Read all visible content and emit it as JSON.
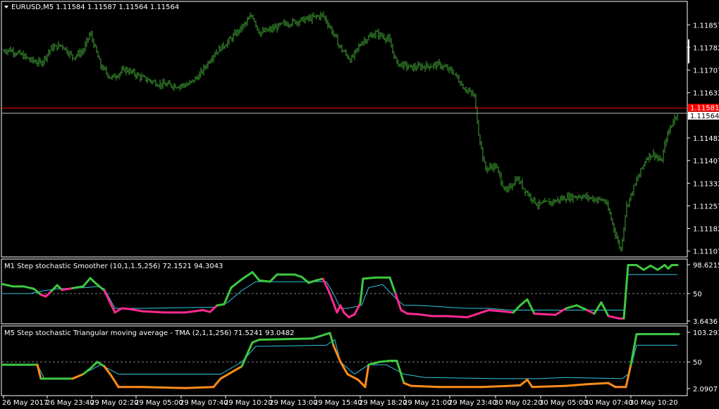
{
  "colors": {
    "background": "#000000",
    "frame": "#ffffff",
    "bar": "#3fa535",
    "bid_line": "#c0c0c0",
    "ask_line": "#ff0000",
    "stoch_up": "#3fc83f",
    "stoch_down": "#ff2a90",
    "tma_down": "#ff8c1a",
    "signal": "#33c7e0",
    "level": "#808080"
  },
  "header": {
    "symbol_menu_icon": "triangle-down-icon",
    "text": "EURUSD,M5  1.11584 1.11587 1.11564 1.11564"
  },
  "price_badges": {
    "ask": "1.11581",
    "bid": "1.11564"
  },
  "chart_data": [
    {
      "type": "bar",
      "title": "EURUSD,M5",
      "ohlc_last": {
        "open": 1.11584,
        "high": 1.11587,
        "low": 1.11564,
        "close": 1.11564
      },
      "ylim": [
        1.1109,
        1.1193
      ],
      "y_ticks": [
        "1.11857",
        "1.11782",
        "1.11707",
        "1.11632",
        "1.11482",
        "1.11407",
        "1.11332",
        "1.11257",
        "1.11182",
        "1.11107"
      ],
      "x_ticks": [
        "26 May 2017",
        "26 May 23:40",
        "29 May 02:20",
        "29 May 05:00",
        "29 May 07:40",
        "29 May 10:20",
        "29 May 13:00",
        "29 May 15:40",
        "29 May 18:20",
        "29 May 21:00",
        "29 May 23:40",
        "30 May 02:20",
        "30 May 05:00",
        "30 May 07:40",
        "30 May 10:20"
      ],
      "ask": 1.11581,
      "bid": 1.11564,
      "close_path": [
        [
          0,
          1.1177
        ],
        [
          10,
          1.11775
        ],
        [
          25,
          1.1176
        ],
        [
          40,
          1.1174
        ],
        [
          55,
          1.1173
        ],
        [
          70,
          1.1178
        ],
        [
          85,
          1.1179
        ],
        [
          100,
          1.1175
        ],
        [
          115,
          1.1177
        ],
        [
          125,
          1.1183
        ],
        [
          140,
          1.1172
        ],
        [
          155,
          1.1168
        ],
        [
          175,
          1.1171
        ],
        [
          200,
          1.1168
        ],
        [
          225,
          1.1166
        ],
        [
          250,
          1.11655
        ],
        [
          265,
          1.1166
        ],
        [
          280,
          1.1169
        ],
        [
          300,
          1.1176
        ],
        [
          320,
          1.118
        ],
        [
          345,
          1.1186
        ],
        [
          355,
          1.1189
        ],
        [
          365,
          1.1183
        ],
        [
          380,
          1.1184
        ],
        [
          400,
          1.1186
        ],
        [
          420,
          1.1187
        ],
        [
          440,
          1.1188
        ],
        [
          455,
          1.1189
        ],
        [
          465,
          1.1185
        ],
        [
          480,
          1.1178
        ],
        [
          495,
          1.1174
        ],
        [
          510,
          1.118
        ],
        [
          530,
          1.1183
        ],
        [
          548,
          1.1181
        ],
        [
          560,
          1.1173
        ],
        [
          580,
          1.11715
        ],
        [
          600,
          1.1172
        ],
        [
          620,
          1.11725
        ],
        [
          640,
          1.117
        ],
        [
          655,
          1.1165
        ],
        [
          670,
          1.1162
        ],
        [
          676,
          1.115
        ],
        [
          685,
          1.1138
        ],
        [
          700,
          1.1139
        ],
        [
          715,
          1.113
        ],
        [
          730,
          1.1135
        ],
        [
          745,
          1.113
        ],
        [
          760,
          1.1126
        ],
        [
          780,
          1.1127
        ],
        [
          800,
          1.11285
        ],
        [
          820,
          1.1129
        ],
        [
          840,
          1.1128
        ],
        [
          855,
          1.11275
        ],
        [
          862,
          1.1123
        ],
        [
          872,
          1.1115
        ],
        [
          878,
          1.1111
        ],
        [
          885,
          1.1125
        ],
        [
          900,
          1.1134
        ],
        [
          915,
          1.1142
        ],
        [
          925,
          1.1143
        ],
        [
          935,
          1.114
        ],
        [
          942,
          1.1148
        ],
        [
          952,
          1.1154
        ],
        [
          958,
          1.11564
        ]
      ]
    },
    {
      "type": "line",
      "title": "M1 Step stochastic Smoother (10,1,1.5,256) 72.1521 94.3043",
      "main_value": "72.1521",
      "signal_value": "94.3043",
      "ylim": [
        3.6436,
        98.6215
      ],
      "y_ticks": [
        "98.6215",
        "50",
        "3.6436"
      ],
      "levels": [
        50
      ],
      "series": [
        {
          "role": "main",
          "values": [
            [
              0,
              66
            ],
            [
              15,
              62
            ],
            [
              30,
              62
            ],
            [
              45,
              58
            ],
            [
              55,
              48
            ],
            [
              62,
              45
            ],
            [
              70,
              54
            ],
            [
              78,
              64
            ],
            [
              85,
              56
            ],
            [
              100,
              59
            ],
            [
              115,
              62
            ],
            [
              125,
              76
            ],
            [
              133,
              67
            ],
            [
              145,
              55
            ],
            [
              160,
              18
            ],
            [
              170,
              25
            ],
            [
              180,
              24
            ],
            [
              200,
              20
            ],
            [
              230,
              18
            ],
            [
              260,
              18
            ],
            [
              285,
              22
            ],
            [
              295,
              19
            ],
            [
              305,
              30
            ],
            [
              315,
              32
            ],
            [
              325,
              60
            ],
            [
              340,
              74
            ],
            [
              355,
              86
            ],
            [
              365,
              72
            ],
            [
              380,
              70
            ],
            [
              390,
              82
            ],
            [
              415,
              82
            ],
            [
              425,
              78
            ],
            [
              435,
              68
            ],
            [
              445,
              72
            ],
            [
              455,
              75
            ],
            [
              465,
              50
            ],
            [
              475,
              18
            ],
            [
              480,
              30
            ],
            [
              485,
              18
            ],
            [
              492,
              10
            ],
            [
              500,
              15
            ],
            [
              508,
              33
            ],
            [
              512,
              75
            ],
            [
              530,
              77
            ],
            [
              550,
              77
            ],
            [
              558,
              50
            ],
            [
              566,
              22
            ],
            [
              575,
              16
            ],
            [
              590,
              15
            ],
            [
              610,
              12
            ],
            [
              630,
              12
            ],
            [
              660,
              10
            ],
            [
              690,
              22
            ],
            [
              710,
              20
            ],
            [
              725,
              18
            ],
            [
              735,
              30
            ],
            [
              745,
              40
            ],
            [
              755,
              16
            ],
            [
              770,
              15
            ],
            [
              785,
              14
            ],
            [
              800,
              25
            ],
            [
              815,
              30
            ],
            [
              830,
              22
            ],
            [
              840,
              16
            ],
            [
              850,
              35
            ],
            [
              860,
              12
            ],
            [
              875,
              8
            ],
            [
              882,
              8
            ],
            [
              888,
              98
            ],
            [
              900,
              98
            ],
            [
              910,
              90
            ],
            [
              920,
              97
            ],
            [
              930,
              90
            ],
            [
              940,
              98
            ],
            [
              945,
              92
            ],
            [
              950,
              98
            ],
            [
              958,
              98
            ]
          ]
        },
        {
          "role": "signal",
          "values": [
            [
              0,
              50
            ],
            [
              40,
              50
            ],
            [
              60,
              55
            ],
            [
              80,
              58
            ],
            [
              120,
              60
            ],
            [
              135,
              62
            ],
            [
              145,
              58
            ],
            [
              160,
              25
            ],
            [
              200,
              25
            ],
            [
              300,
              27
            ],
            [
              320,
              35
            ],
            [
              340,
              55
            ],
            [
              360,
              70
            ],
            [
              420,
              70
            ],
            [
              460,
              70
            ],
            [
              470,
              50
            ],
            [
              480,
              25
            ],
            [
              490,
              25
            ],
            [
              510,
              30
            ],
            [
              520,
              60
            ],
            [
              540,
              65
            ],
            [
              560,
              40
            ],
            [
              570,
              30
            ],
            [
              590,
              30
            ],
            [
              660,
              25
            ],
            [
              690,
              25
            ],
            [
              720,
              22
            ],
            [
              800,
              22
            ],
            [
              860,
              22
            ],
            [
              882,
              22
            ],
            [
              888,
              82
            ],
            [
              958,
              82
            ]
          ]
        }
      ]
    },
    {
      "type": "line",
      "title": "M5 Step stochastic Triangular moving average - TMA (2,1,1,256) 71.5241 93.0482",
      "main_value": "71.5241",
      "signal_value": "93.0482",
      "ylim": [
        2.0907,
        103.2939
      ],
      "y_ticks": [
        "103.2939",
        "50",
        "2.0907"
      ],
      "levels": [
        50
      ],
      "series": [
        {
          "role": "main",
          "values": [
            [
              0,
              45
            ],
            [
              50,
              45
            ],
            [
              55,
              20
            ],
            [
              100,
              20
            ],
            [
              115,
              28
            ],
            [
              125,
              38
            ],
            [
              135,
              50
            ],
            [
              145,
              42
            ],
            [
              155,
              25
            ],
            [
              165,
              5
            ],
            [
              200,
              5
            ],
            [
              260,
              3
            ],
            [
              300,
              5
            ],
            [
              310,
              20
            ],
            [
              340,
              42
            ],
            [
              355,
              85
            ],
            [
              365,
              90
            ],
            [
              440,
              92
            ],
            [
              460,
              100
            ],
            [
              465,
              102
            ],
            [
              470,
              80
            ],
            [
              480,
              50
            ],
            [
              490,
              28
            ],
            [
              505,
              18
            ],
            [
              515,
              5
            ],
            [
              520,
              45
            ],
            [
              535,
              50
            ],
            [
              550,
              52
            ],
            [
              560,
              52
            ],
            [
              570,
              12
            ],
            [
              580,
              7
            ],
            [
              620,
              5
            ],
            [
              680,
              5
            ],
            [
              720,
              7
            ],
            [
              735,
              8
            ],
            [
              745,
              18
            ],
            [
              752,
              5
            ],
            [
              800,
              7
            ],
            [
              830,
              10
            ],
            [
              860,
              12
            ],
            [
              870,
              5
            ],
            [
              885,
              5
            ],
            [
              892,
              45
            ],
            [
              900,
              100
            ],
            [
              960,
              100
            ]
          ]
        },
        {
          "role": "signal",
          "values": [
            [
              0,
              45
            ],
            [
              50,
              45
            ],
            [
              60,
              20
            ],
            [
              100,
              20
            ],
            [
              125,
              35
            ],
            [
              140,
              45
            ],
            [
              165,
              28
            ],
            [
              310,
              28
            ],
            [
              340,
              50
            ],
            [
              360,
              78
            ],
            [
              460,
              80
            ],
            [
              472,
              90
            ],
            [
              480,
              50
            ],
            [
              500,
              28
            ],
            [
              520,
              45
            ],
            [
              545,
              45
            ],
            [
              570,
              28
            ],
            [
              600,
              22
            ],
            [
              700,
              20
            ],
            [
              760,
              20
            ],
            [
              800,
              22
            ],
            [
              880,
              20
            ],
            [
              890,
              30
            ],
            [
              900,
              80
            ],
            [
              958,
              80
            ]
          ]
        }
      ]
    }
  ]
}
